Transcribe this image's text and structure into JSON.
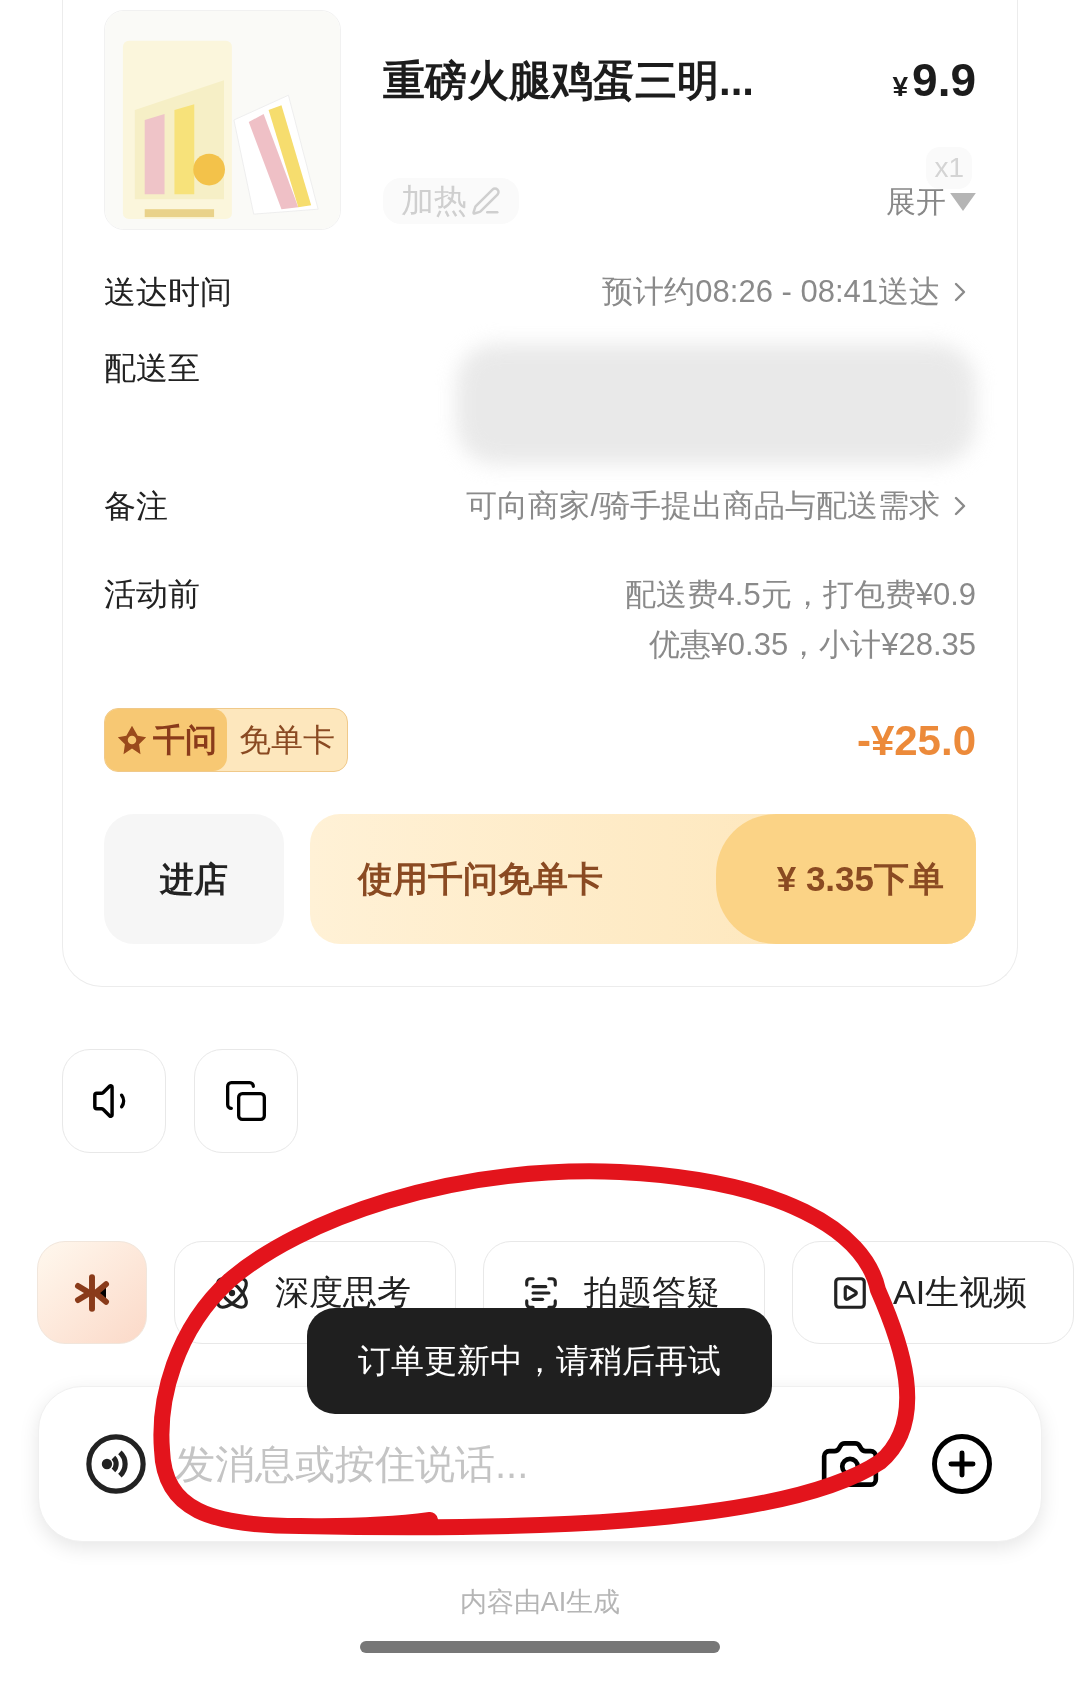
{
  "product": {
    "title": "重磅火腿鸡蛋三明...",
    "currency": "¥",
    "price": "9.9",
    "note_tag": {
      "label": "加热",
      "disabled": true
    },
    "quantity": "x1",
    "expand": "展开"
  },
  "rows": [
    {
      "kind": "link",
      "label": "送达时间",
      "value": "预计约08:26 - 08:41送达"
    },
    {
      "kind": "blurred",
      "label": "配送至"
    },
    {
      "kind": "link",
      "label": "备注",
      "value": "可向商家/骑手提出商品与配送需求"
    },
    {
      "kind": "lines",
      "label": "活动前",
      "lines": [
        "配送费4.5元，打包费¥0.9",
        "优惠¥0.35，小计¥28.35"
      ]
    }
  ],
  "discount": {
    "brand": "千问",
    "label": "免单卡",
    "amount": "-¥25.0"
  },
  "buttons": {
    "store": "进店",
    "use_card": "使用千问免单卡",
    "pay": "¥ 3.35下单"
  },
  "chips": [
    {
      "kind": "logo"
    },
    {
      "kind": "atom",
      "label": "深度思考"
    },
    {
      "label": "拍题答疑"
    },
    {
      "kind": "video",
      "label": "AI生视频"
    }
  ],
  "toast": "订单更新中，请稍后再试",
  "input": {
    "placeholder": "发消息或按住说话..."
  },
  "footer": "内容由AI生成"
}
